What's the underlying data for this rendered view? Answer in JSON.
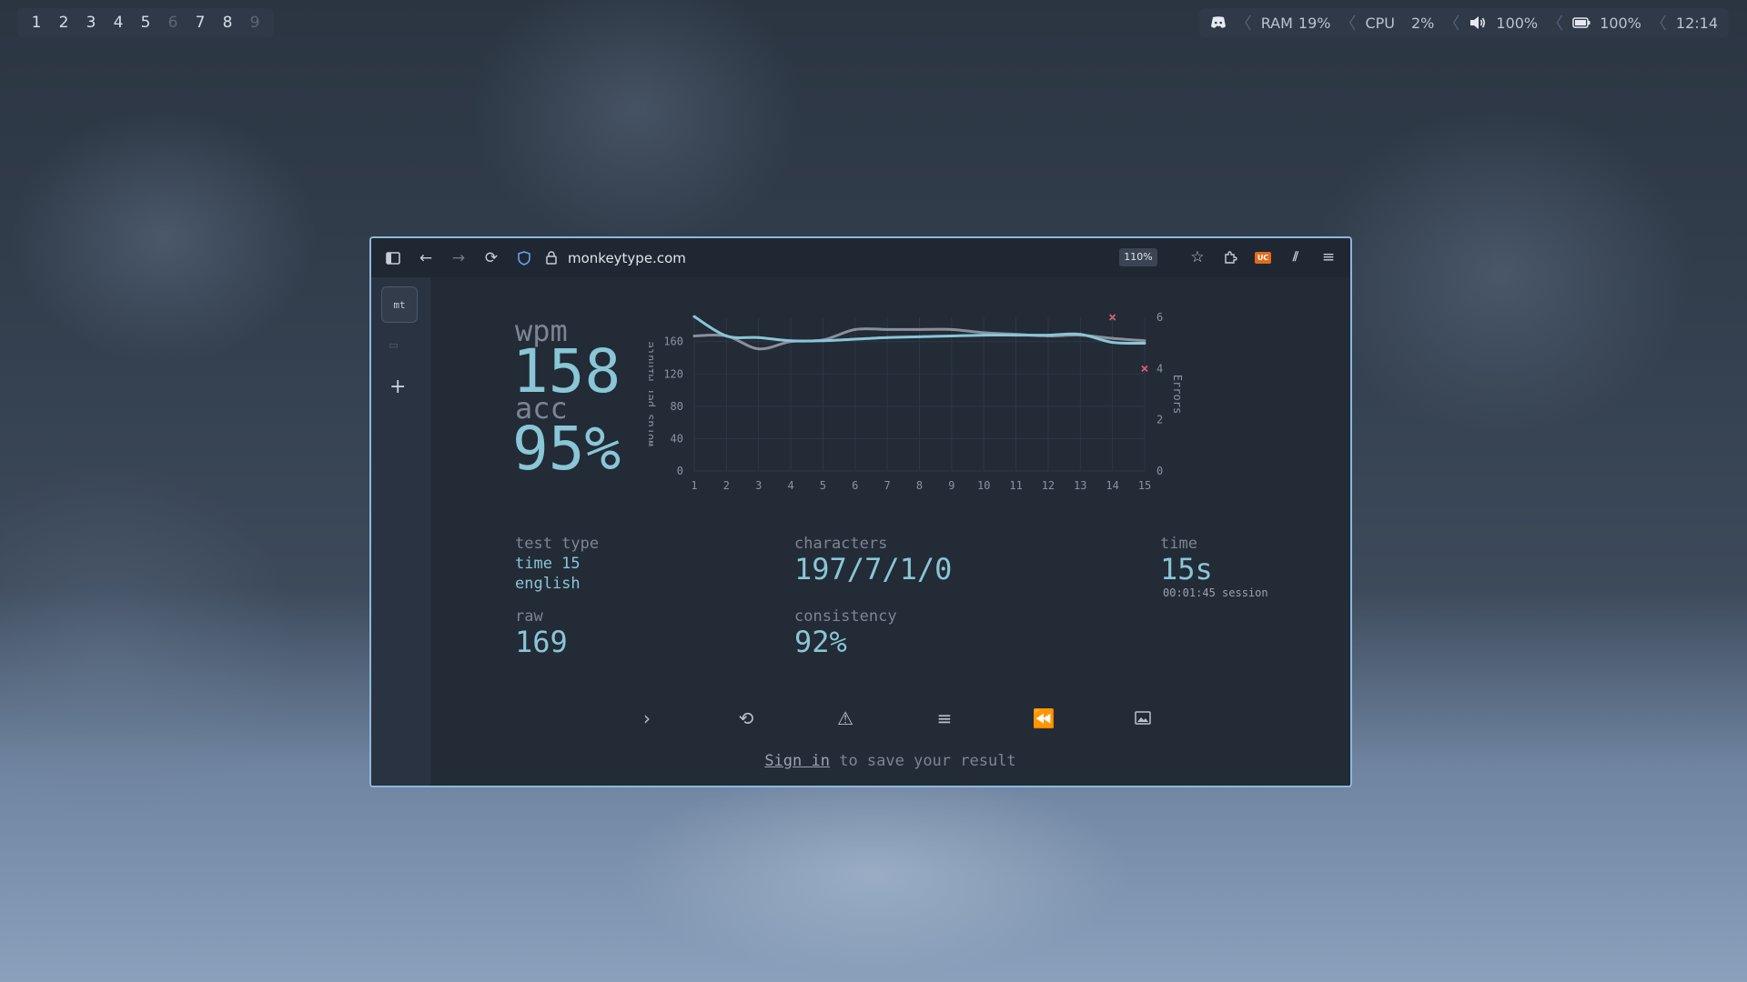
{
  "workspaces": [
    {
      "n": "1",
      "state": "normal"
    },
    {
      "n": "2",
      "state": "normal"
    },
    {
      "n": "3",
      "state": "normal"
    },
    {
      "n": "4",
      "state": "normal"
    },
    {
      "n": "5",
      "state": "normal"
    },
    {
      "n": "6",
      "state": "dim"
    },
    {
      "n": "7",
      "state": "normal"
    },
    {
      "n": "8",
      "state": "normal"
    },
    {
      "n": "9",
      "state": "dim"
    }
  ],
  "status": {
    "discord_icon": "discord-icon",
    "ram_label": "RAM",
    "ram_value": "19%",
    "cpu_label": "CPU",
    "cpu_value": "2%",
    "volume_icon": "speaker-icon",
    "volume_value": "100%",
    "battery_icon": "battery-icon",
    "battery_value": "100%",
    "clock": "12:14"
  },
  "browser": {
    "url": "monkeytype.com",
    "zoom": "110%",
    "extension_badge": "UC"
  },
  "sidebar": {
    "logo_text": "mt"
  },
  "result": {
    "wpm_label": "wpm",
    "wpm_value": "158",
    "acc_label": "acc",
    "acc_value": "95%",
    "test_type_label": "test type",
    "test_type_mode": "time 15",
    "test_type_language": "english",
    "raw_label": "raw",
    "raw_value": "169",
    "characters_label": "characters",
    "characters_value": "197/7/1/0",
    "consistency_label": "consistency",
    "consistency_value": "92%",
    "time_label": "time",
    "time_value": "15s",
    "session_time": "00:01:45 session",
    "signin_link": "Sign in",
    "signin_rest": " to save your result"
  },
  "chart_data": {
    "type": "line",
    "x": [
      1,
      2,
      3,
      4,
      5,
      6,
      7,
      8,
      9,
      10,
      11,
      12,
      13,
      14,
      15
    ],
    "ylabel": "Words per Minute",
    "y2label": "Errors",
    "ylim": [
      0,
      190
    ],
    "y2lim": [
      0,
      6
    ],
    "yticks": [
      0,
      40,
      80,
      120,
      160
    ],
    "y2ticks": [
      0,
      2,
      4,
      6
    ],
    "series": [
      {
        "role": "wpm",
        "color": "#89c6d6",
        "values": [
          191,
          167,
          165,
          161,
          161,
          163,
          165,
          166,
          167,
          168,
          168,
          168,
          169,
          159,
          158
        ]
      },
      {
        "role": "raw",
        "color": "#8a8f9c",
        "values": [
          167,
          167,
          151,
          160,
          162,
          175,
          175,
          175,
          175,
          171,
          169,
          167,
          168,
          164,
          161
        ]
      }
    ],
    "errors": [
      {
        "x": 14,
        "y": 6
      },
      {
        "x": 15,
        "y": 4
      }
    ],
    "error_color": "#d35f6f",
    "grid": true
  }
}
